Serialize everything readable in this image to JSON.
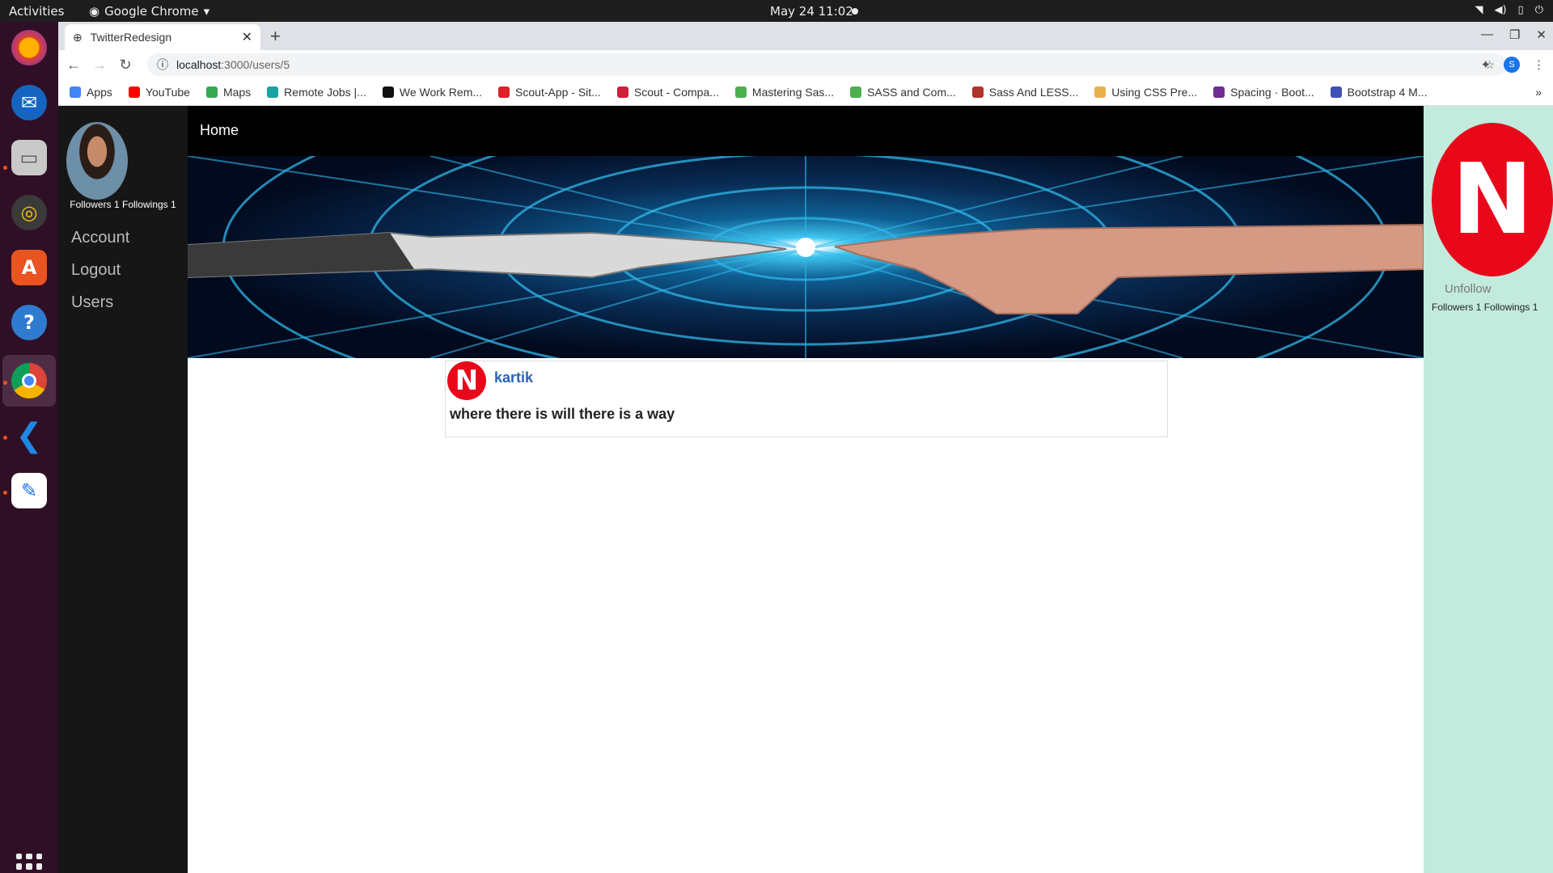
{
  "os_topbar": {
    "activities": "Activities",
    "app_name": "Google Chrome",
    "datetime": "May 24  11:02"
  },
  "browser": {
    "tab_title": "TwitterRedesign",
    "url_host": "localhost",
    "url_path": ":3000/users/5",
    "profile_initial": "S",
    "bookmarks": [
      {
        "label": "Apps",
        "color": "#4285f4"
      },
      {
        "label": "YouTube",
        "color": "#ff0000"
      },
      {
        "label": "Maps",
        "color": "#34a853"
      },
      {
        "label": "Remote Jobs |...",
        "color": "#1aa3a3"
      },
      {
        "label": "We Work Rem...",
        "color": "#111111"
      },
      {
        "label": "Scout-App - Sit...",
        "color": "#e0202a"
      },
      {
        "label": "Scout - Compa...",
        "color": "#d0203a"
      },
      {
        "label": "Mastering Sas...",
        "color": "#4caf50"
      },
      {
        "label": "SASS and Com...",
        "color": "#4caf50"
      },
      {
        "label": "Sass And LESS...",
        "color": "#b0342c"
      },
      {
        "label": "Using CSS Pre...",
        "color": "#e8b04a"
      },
      {
        "label": "Spacing · Boot...",
        "color": "#6f2c91"
      },
      {
        "label": "Bootstrap 4 M...",
        "color": "#3f51b5"
      }
    ]
  },
  "left_sidebar": {
    "followers_text": "Followers 1 Followings 1",
    "nav": [
      "Account",
      "Logout",
      "Users"
    ]
  },
  "main": {
    "home_link": "Home",
    "tweet": {
      "author": "kartik",
      "avatar_letter": "N",
      "text": "where there is will there is a way"
    }
  },
  "right_sidebar": {
    "avatar_letter": "N",
    "unfollow_label": "Unfollow",
    "followers_text": "Followers 1 Followings 1"
  },
  "colors": {
    "accent_red": "#e8081a",
    "link_blue": "#2a64b4",
    "right_panel_bg": "#c2ebde",
    "left_panel_bg": "#161616"
  }
}
